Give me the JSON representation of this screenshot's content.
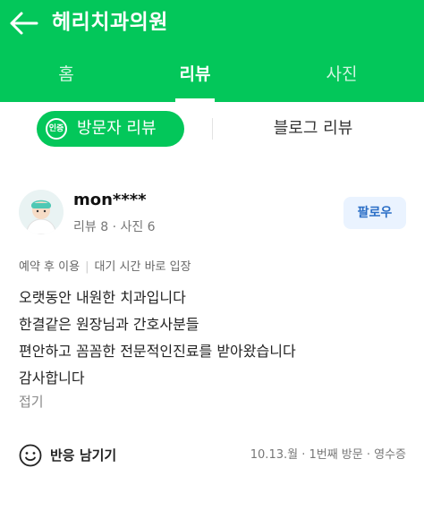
{
  "header": {
    "title": "헤리치과의원"
  },
  "tabs": [
    "홈",
    "리뷰",
    "사진"
  ],
  "subtabs": {
    "badge": "인증",
    "visitor": "방문자 리뷰",
    "blog": "블로그 리뷰"
  },
  "review": {
    "nickname": "mon****",
    "stats": "리뷰 8 · 사진 6",
    "follow": "팔로우",
    "tags": [
      "예약 후 이용",
      "대기 시간 바로 입장"
    ],
    "lines": [
      "오랫동안 내원한 치과입니다",
      "한결같은 원장님과 간호사분들",
      "편안하고 꼼꼼한 전문적인진료를 받아왔습니다",
      "감사합니다"
    ],
    "fold": "접기",
    "reaction": "반응 남기기",
    "visit_info": "10.13.월 · 1번째 방문 · 영수증"
  },
  "colors": {
    "brand": "#03c75a",
    "follow_bg": "#eaf3ff",
    "follow_text": "#2a6ec6"
  }
}
